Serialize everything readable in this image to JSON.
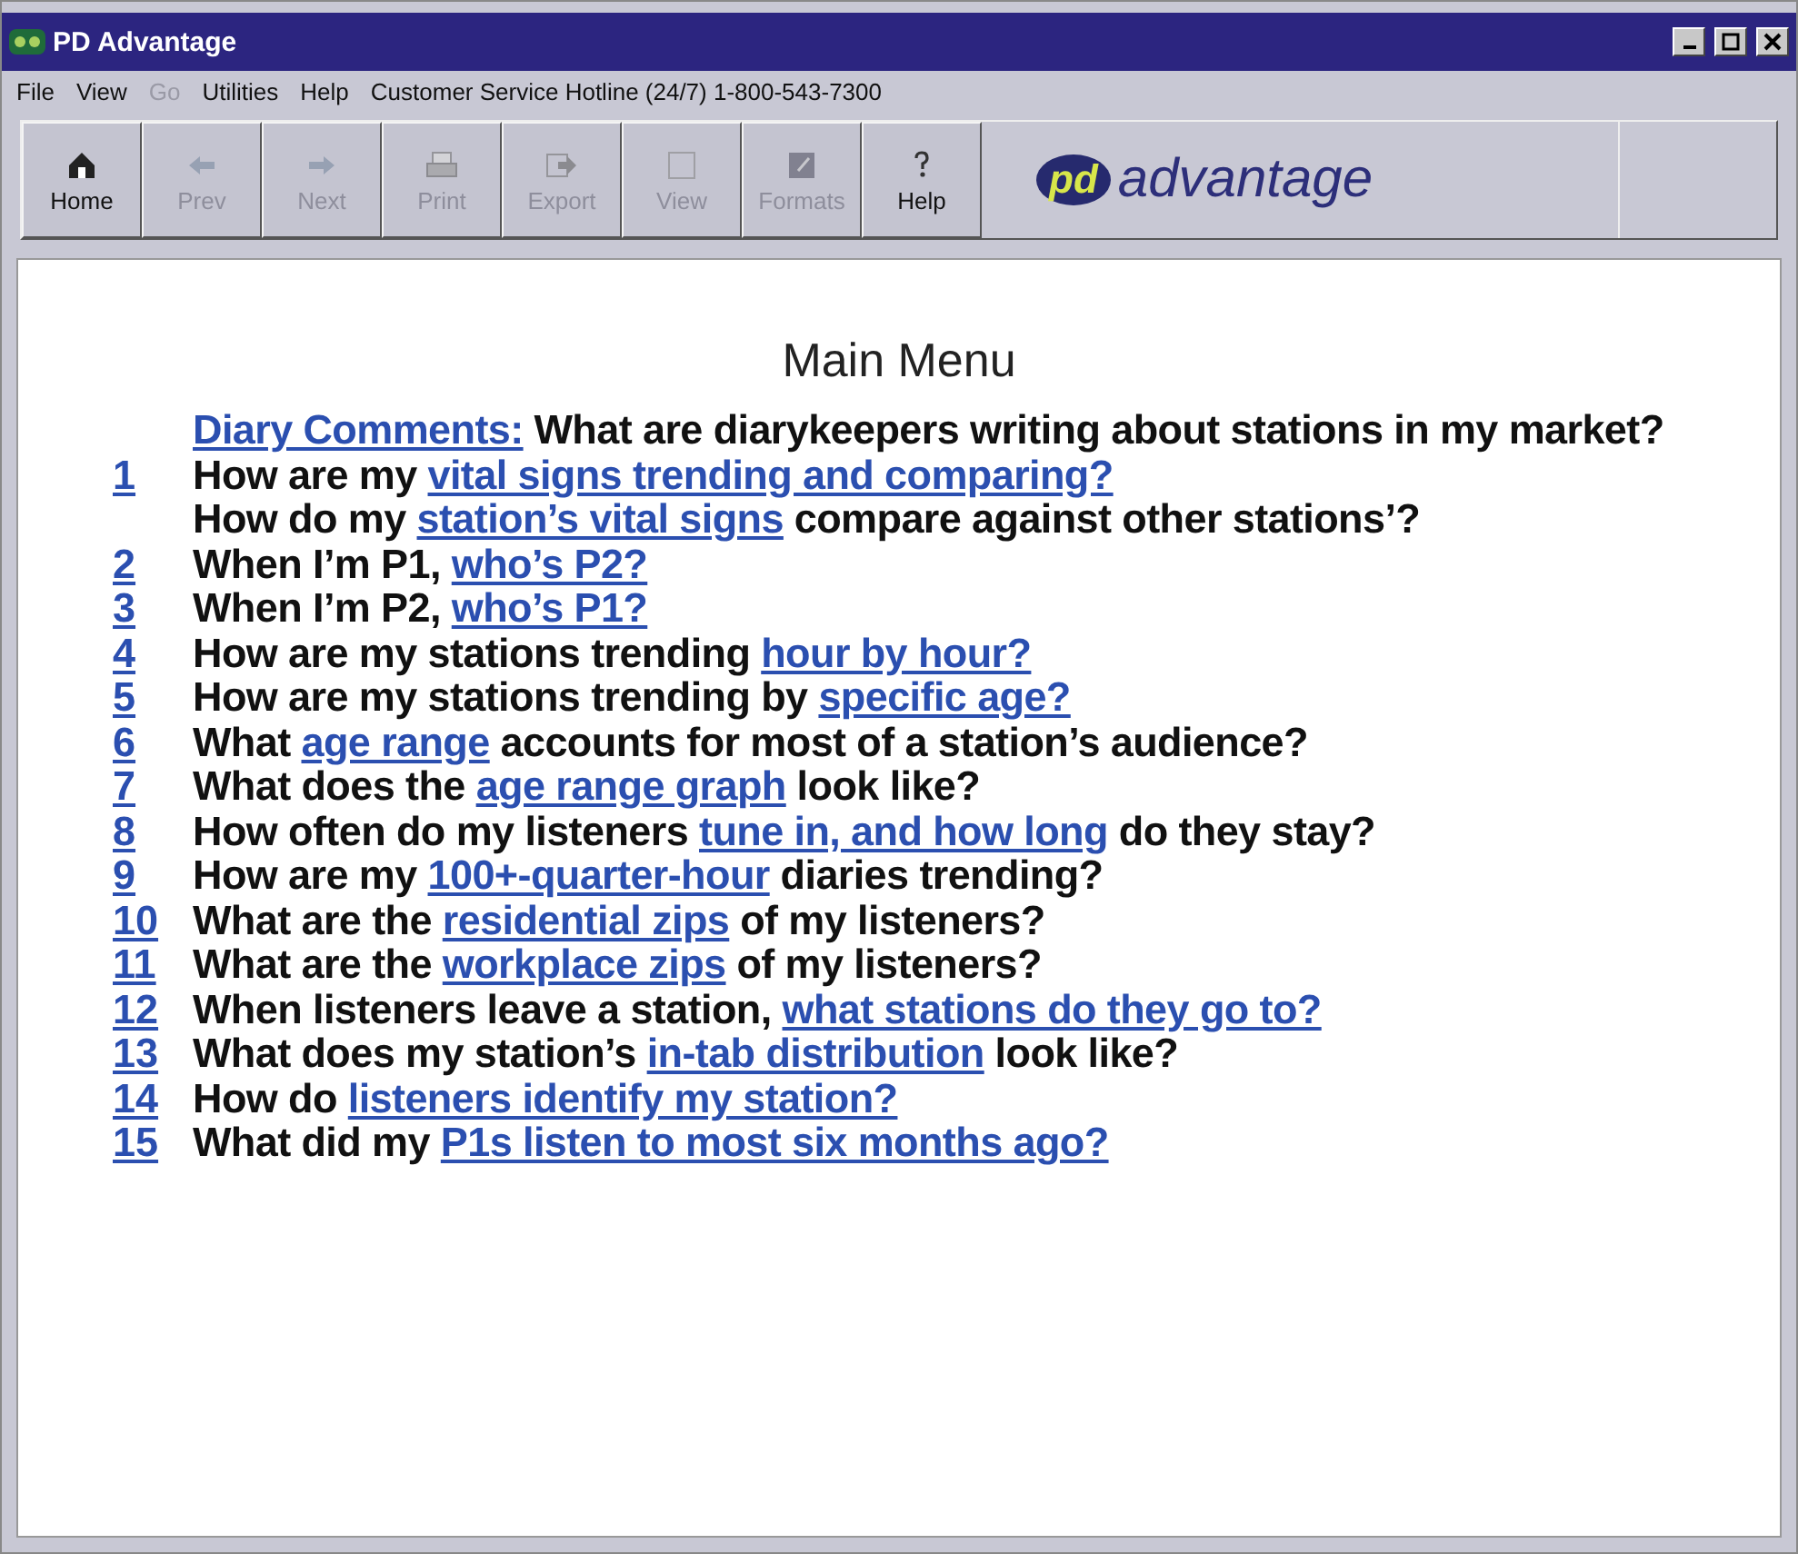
{
  "window": {
    "title": "PD Advantage"
  },
  "menu": [
    {
      "label": "File",
      "disabled": false
    },
    {
      "label": "View",
      "disabled": false
    },
    {
      "label": "Go",
      "disabled": true
    },
    {
      "label": "Utilities",
      "disabled": false
    },
    {
      "label": "Help",
      "disabled": false
    },
    {
      "label": "Customer Service Hotline (24/7) 1-800-543-7300",
      "disabled": false
    }
  ],
  "toolbar": [
    {
      "label": "Home",
      "kind": "home",
      "disabled": false
    },
    {
      "label": "Prev",
      "kind": "prev",
      "disabled": true
    },
    {
      "label": "Next",
      "kind": "next",
      "disabled": true
    },
    {
      "label": "Print",
      "kind": "print",
      "disabled": true
    },
    {
      "label": "Export",
      "kind": "export",
      "disabled": true
    },
    {
      "label": "View",
      "kind": "view",
      "disabled": true
    },
    {
      "label": "Formats",
      "kind": "formats",
      "disabled": true
    },
    {
      "label": "Help",
      "kind": "help",
      "disabled": false
    }
  ],
  "logo": {
    "badge": "pd",
    "text": "advantage"
  },
  "heading": "Main Menu",
  "items": [
    {
      "segments": [
        {
          "text": "Diary Comments:",
          "link": true
        },
        {
          "text": " What are diarykeepers writing about stations in my market?",
          "link": false
        }
      ]
    },
    {
      "number": "1",
      "segments": [
        {
          "text": "How are my ",
          "link": false
        },
        {
          "text": "vital signs trending and comparing?",
          "link": true
        }
      ]
    },
    {
      "segments": [
        {
          "text": "How do my ",
          "link": false
        },
        {
          "text": "station’s vital signs",
          "link": true
        },
        {
          "text": " compare against other stations’?",
          "link": false
        }
      ]
    },
    {
      "number": "2",
      "segments": [
        {
          "text": "When I’m P1, ",
          "link": false
        },
        {
          "text": "who’s P2?",
          "link": true
        }
      ]
    },
    {
      "number": "3",
      "segments": [
        {
          "text": "When I’m P2, ",
          "link": false
        },
        {
          "text": "who’s P1?",
          "link": true
        }
      ]
    },
    {
      "number": "4",
      "segments": [
        {
          "text": "How are my stations trending ",
          "link": false
        },
        {
          "text": "hour by hour?",
          "link": true
        }
      ]
    },
    {
      "number": "5",
      "segments": [
        {
          "text": "How are my stations trending by ",
          "link": false
        },
        {
          "text": "specific age?",
          "link": true
        }
      ]
    },
    {
      "number": "6",
      "segments": [
        {
          "text": "What ",
          "link": false
        },
        {
          "text": "age range",
          "link": true
        },
        {
          "text": " accounts for most of a station’s audience?",
          "link": false
        }
      ]
    },
    {
      "number": "7",
      "segments": [
        {
          "text": "What does the ",
          "link": false
        },
        {
          "text": "age range graph",
          "link": true
        },
        {
          "text": " look like?",
          "link": false
        }
      ]
    },
    {
      "number": "8",
      "segments": [
        {
          "text": "How often do my listeners ",
          "link": false
        },
        {
          "text": "tune in, and how long",
          "link": true
        },
        {
          "text": " do they stay?",
          "link": false
        }
      ]
    },
    {
      "number": "9",
      "segments": [
        {
          "text": "How are my ",
          "link": false
        },
        {
          "text": "100+-quarter-hour",
          "link": true
        },
        {
          "text": " diaries trending?",
          "link": false
        }
      ]
    },
    {
      "number": "10",
      "segments": [
        {
          "text": "What are the ",
          "link": false
        },
        {
          "text": "residential zips",
          "link": true
        },
        {
          "text": " of my listeners?",
          "link": false
        }
      ]
    },
    {
      "number": "11",
      "segments": [
        {
          "text": "What are the ",
          "link": false
        },
        {
          "text": "workplace zips",
          "link": true
        },
        {
          "text": " of my listeners?",
          "link": false
        }
      ]
    },
    {
      "number": "12",
      "segments": [
        {
          "text": "When listeners leave a station, ",
          "link": false
        },
        {
          "text": "what stations do they go to?",
          "link": true
        }
      ]
    },
    {
      "number": "13",
      "segments": [
        {
          "text": "What does my station’s ",
          "link": false
        },
        {
          "text": "in-tab distribution",
          "link": true
        },
        {
          "text": " look like?",
          "link": false
        }
      ]
    },
    {
      "number": "14",
      "segments": [
        {
          "text": "How do ",
          "link": false
        },
        {
          "text": "listeners identify my station?",
          "link": true
        }
      ]
    },
    {
      "number": "15",
      "segments": [
        {
          "text": "What did my ",
          "link": false
        },
        {
          "text": "P1s listen to most six months ago?",
          "link": true
        }
      ]
    }
  ]
}
